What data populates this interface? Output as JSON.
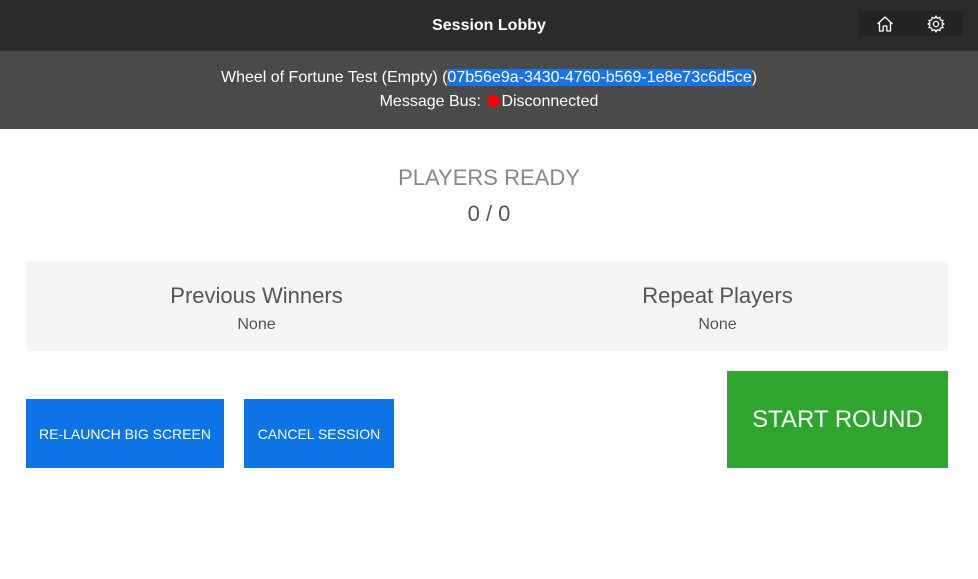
{
  "header": {
    "title": "Session Lobby",
    "icons": [
      "home-icon",
      "gear-icon"
    ]
  },
  "session": {
    "name": "Wheel of Fortune Test (Empty)",
    "open_paren": " (",
    "id": "07b56e9a-3430-4760-b569-1e8e73c6d5ce",
    "close_paren": ")",
    "bus_label": "Message Bus:",
    "bus_status": "Disconnected",
    "bus_status_color": "#ff0000"
  },
  "players": {
    "label": "PLAYERS READY",
    "count": "0 / 0"
  },
  "summary": {
    "previous_winners": {
      "title": "Previous Winners",
      "value": "None"
    },
    "repeat_players": {
      "title": "Repeat Players",
      "value": "None"
    }
  },
  "actions": {
    "relaunch": "RE-LAUNCH BIG SCREEN",
    "cancel": "CANCEL SESSION",
    "start": "START ROUND"
  },
  "colors": {
    "topbar": "#2b2b2b",
    "infobar": "#4a4a4a",
    "primary": "#0d74e7",
    "success": "#2ea52c",
    "selection": "#1773e6"
  }
}
